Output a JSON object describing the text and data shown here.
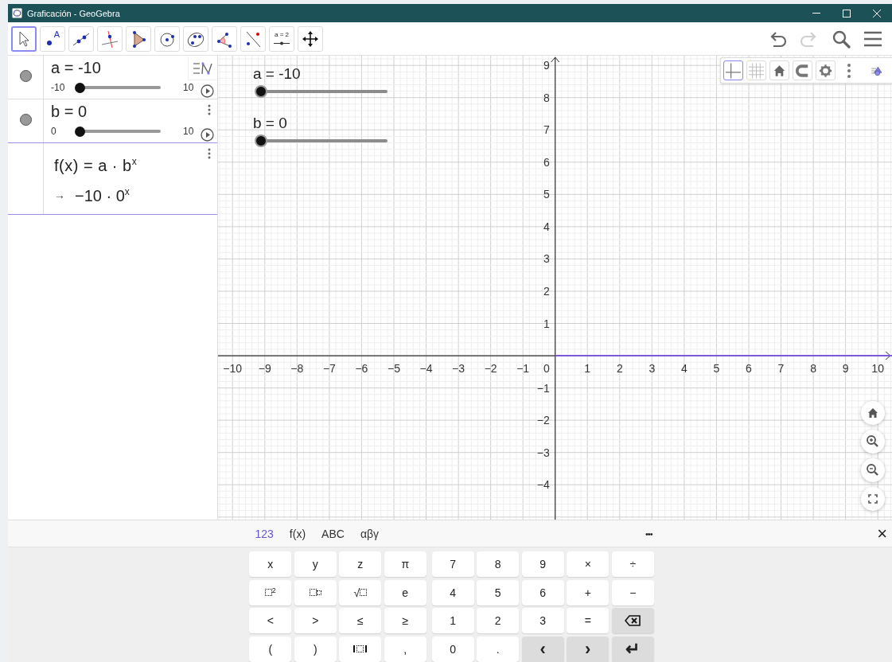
{
  "window": {
    "title": "Graficación - GeoGebra"
  },
  "toolbar": {
    "tools": [
      {
        "kind": "move",
        "selected": true
      },
      {
        "kind": "point",
        "selected": false,
        "label": "A"
      },
      {
        "kind": "line",
        "selected": false
      },
      {
        "kind": "perpendicular",
        "selected": false
      },
      {
        "kind": "polygon",
        "selected": false
      },
      {
        "kind": "circle",
        "selected": false
      },
      {
        "kind": "conic",
        "selected": false
      },
      {
        "kind": "angle",
        "selected": false
      },
      {
        "kind": "reflect",
        "selected": false
      },
      {
        "kind": "slider",
        "selected": false,
        "label": "a = 2"
      },
      {
        "kind": "move-view",
        "selected": false
      }
    ],
    "actions": [
      {
        "kind": "undo",
        "disabled": false
      },
      {
        "kind": "redo",
        "disabled": true
      },
      {
        "kind": "search"
      },
      {
        "kind": "menu"
      }
    ]
  },
  "algebra": {
    "items": [
      {
        "kind": "slider",
        "visible": true,
        "selected": false,
        "label": "a = -10",
        "min": "-10",
        "max": "10",
        "level": 0
      },
      {
        "kind": "slider",
        "visible": true,
        "selected": false,
        "label": "b = 0",
        "min": "0",
        "max": "10",
        "level": 0
      },
      {
        "kind": "function",
        "selected": true,
        "definition": "f(x) = a · b$^{x}$",
        "arrow": "→",
        "result": "−10 · 0$^{x}$"
      }
    ]
  },
  "graphics": {
    "style_bar": [
      {
        "kind": "axes",
        "selected": true
      },
      {
        "kind": "grid",
        "selected": false
      },
      {
        "kind": "home"
      },
      {
        "kind": "magnet"
      },
      {
        "kind": "settings"
      },
      {
        "kind": "more"
      },
      {
        "kind": "view-toggle"
      }
    ],
    "sliders": [
      {
        "label": "a = -10",
        "level": 0
      },
      {
        "label": "b = 0",
        "level": 0
      }
    ],
    "zoom_buttons": [
      {
        "kind": "home"
      },
      {
        "kind": "zoom-in"
      },
      {
        "kind": "zoom-out"
      },
      {
        "kind": "fullscreen"
      }
    ],
    "chart_data": {
      "type": "line",
      "xlim": [
        -10.45,
        10.44
      ],
      "ylim": [
        -5.08,
        9.3
      ],
      "xticks": [
        {
          "value": -10,
          "label": "−10"
        },
        {
          "value": -9,
          "label": "−9"
        },
        {
          "value": -8,
          "label": "−8"
        },
        {
          "value": -7,
          "label": "−7"
        },
        {
          "value": -6,
          "label": "−6"
        },
        {
          "value": -5,
          "label": "−5"
        },
        {
          "value": -4,
          "label": "−4"
        },
        {
          "value": -3,
          "label": "−3"
        },
        {
          "value": -2,
          "label": "−2"
        },
        {
          "value": -1,
          "label": "−1"
        },
        1,
        2,
        3,
        4,
        5,
        6,
        7,
        8,
        9,
        10
      ],
      "yticks": [
        9,
        8,
        7,
        6,
        5,
        4,
        3,
        2,
        1,
        {
          "value": -1,
          "label": "−1"
        },
        {
          "value": -2,
          "label": "−2"
        },
        {
          "value": -3,
          "label": "−3"
        },
        {
          "value": -4,
          "label": "−4"
        }
      ],
      "grid": true,
      "x": [
        0,
        10.44
      ],
      "series": [
        {
          "color": "#7c5cd6",
          "values": [
            0,
            0
          ]
        }
      ]
    },
    "origin_label": "0"
  },
  "keyboard": {
    "tabs": [
      {
        "label": "123",
        "selected": true
      },
      {
        "label": "f(x)",
        "selected": false
      },
      {
        "label": "ABC",
        "selected": false
      },
      {
        "label": "αβγ",
        "selected": false
      }
    ],
    "more": "•••",
    "close": "×",
    "rows": [
      [
        {
          "kind": "text",
          "label": "x"
        },
        {
          "kind": "text",
          "label": "y"
        },
        {
          "kind": "text",
          "label": "z"
        },
        {
          "kind": "text",
          "label": "π"
        },
        {
          "kind": "text",
          "label": "7"
        },
        {
          "kind": "text",
          "label": "8"
        },
        {
          "kind": "text",
          "label": "9"
        },
        {
          "kind": "text",
          "label": "×"
        },
        {
          "kind": "text",
          "label": "÷"
        }
      ],
      [
        {
          "kind": "square",
          "label": "2"
        },
        {
          "kind": "power"
        },
        {
          "kind": "sqrt",
          "label": "√"
        },
        {
          "kind": "text",
          "label": "e"
        },
        {
          "kind": "text",
          "label": "4"
        },
        {
          "kind": "text",
          "label": "5"
        },
        {
          "kind": "text",
          "label": "6"
        },
        {
          "kind": "text",
          "label": "+"
        },
        {
          "kind": "text",
          "label": "−"
        }
      ],
      [
        {
          "kind": "text",
          "label": "<"
        },
        {
          "kind": "text",
          "label": ">"
        },
        {
          "kind": "text",
          "label": "≤"
        },
        {
          "kind": "text",
          "label": "≥"
        },
        {
          "kind": "text",
          "label": "1"
        },
        {
          "kind": "text",
          "label": "2"
        },
        {
          "kind": "text",
          "label": "3"
        },
        {
          "kind": "text",
          "label": "="
        },
        {
          "kind": "backspace"
        }
      ],
      [
        {
          "kind": "text",
          "label": "("
        },
        {
          "kind": "text",
          "label": ")"
        },
        {
          "kind": "abs"
        },
        {
          "kind": "text",
          "label": ","
        },
        {
          "kind": "text",
          "label": "0"
        },
        {
          "kind": "text",
          "label": "."
        },
        {
          "kind": "nav",
          "label": "‹"
        },
        {
          "kind": "nav",
          "label": "›"
        },
        {
          "kind": "nav",
          "label": "↵"
        }
      ]
    ]
  }
}
